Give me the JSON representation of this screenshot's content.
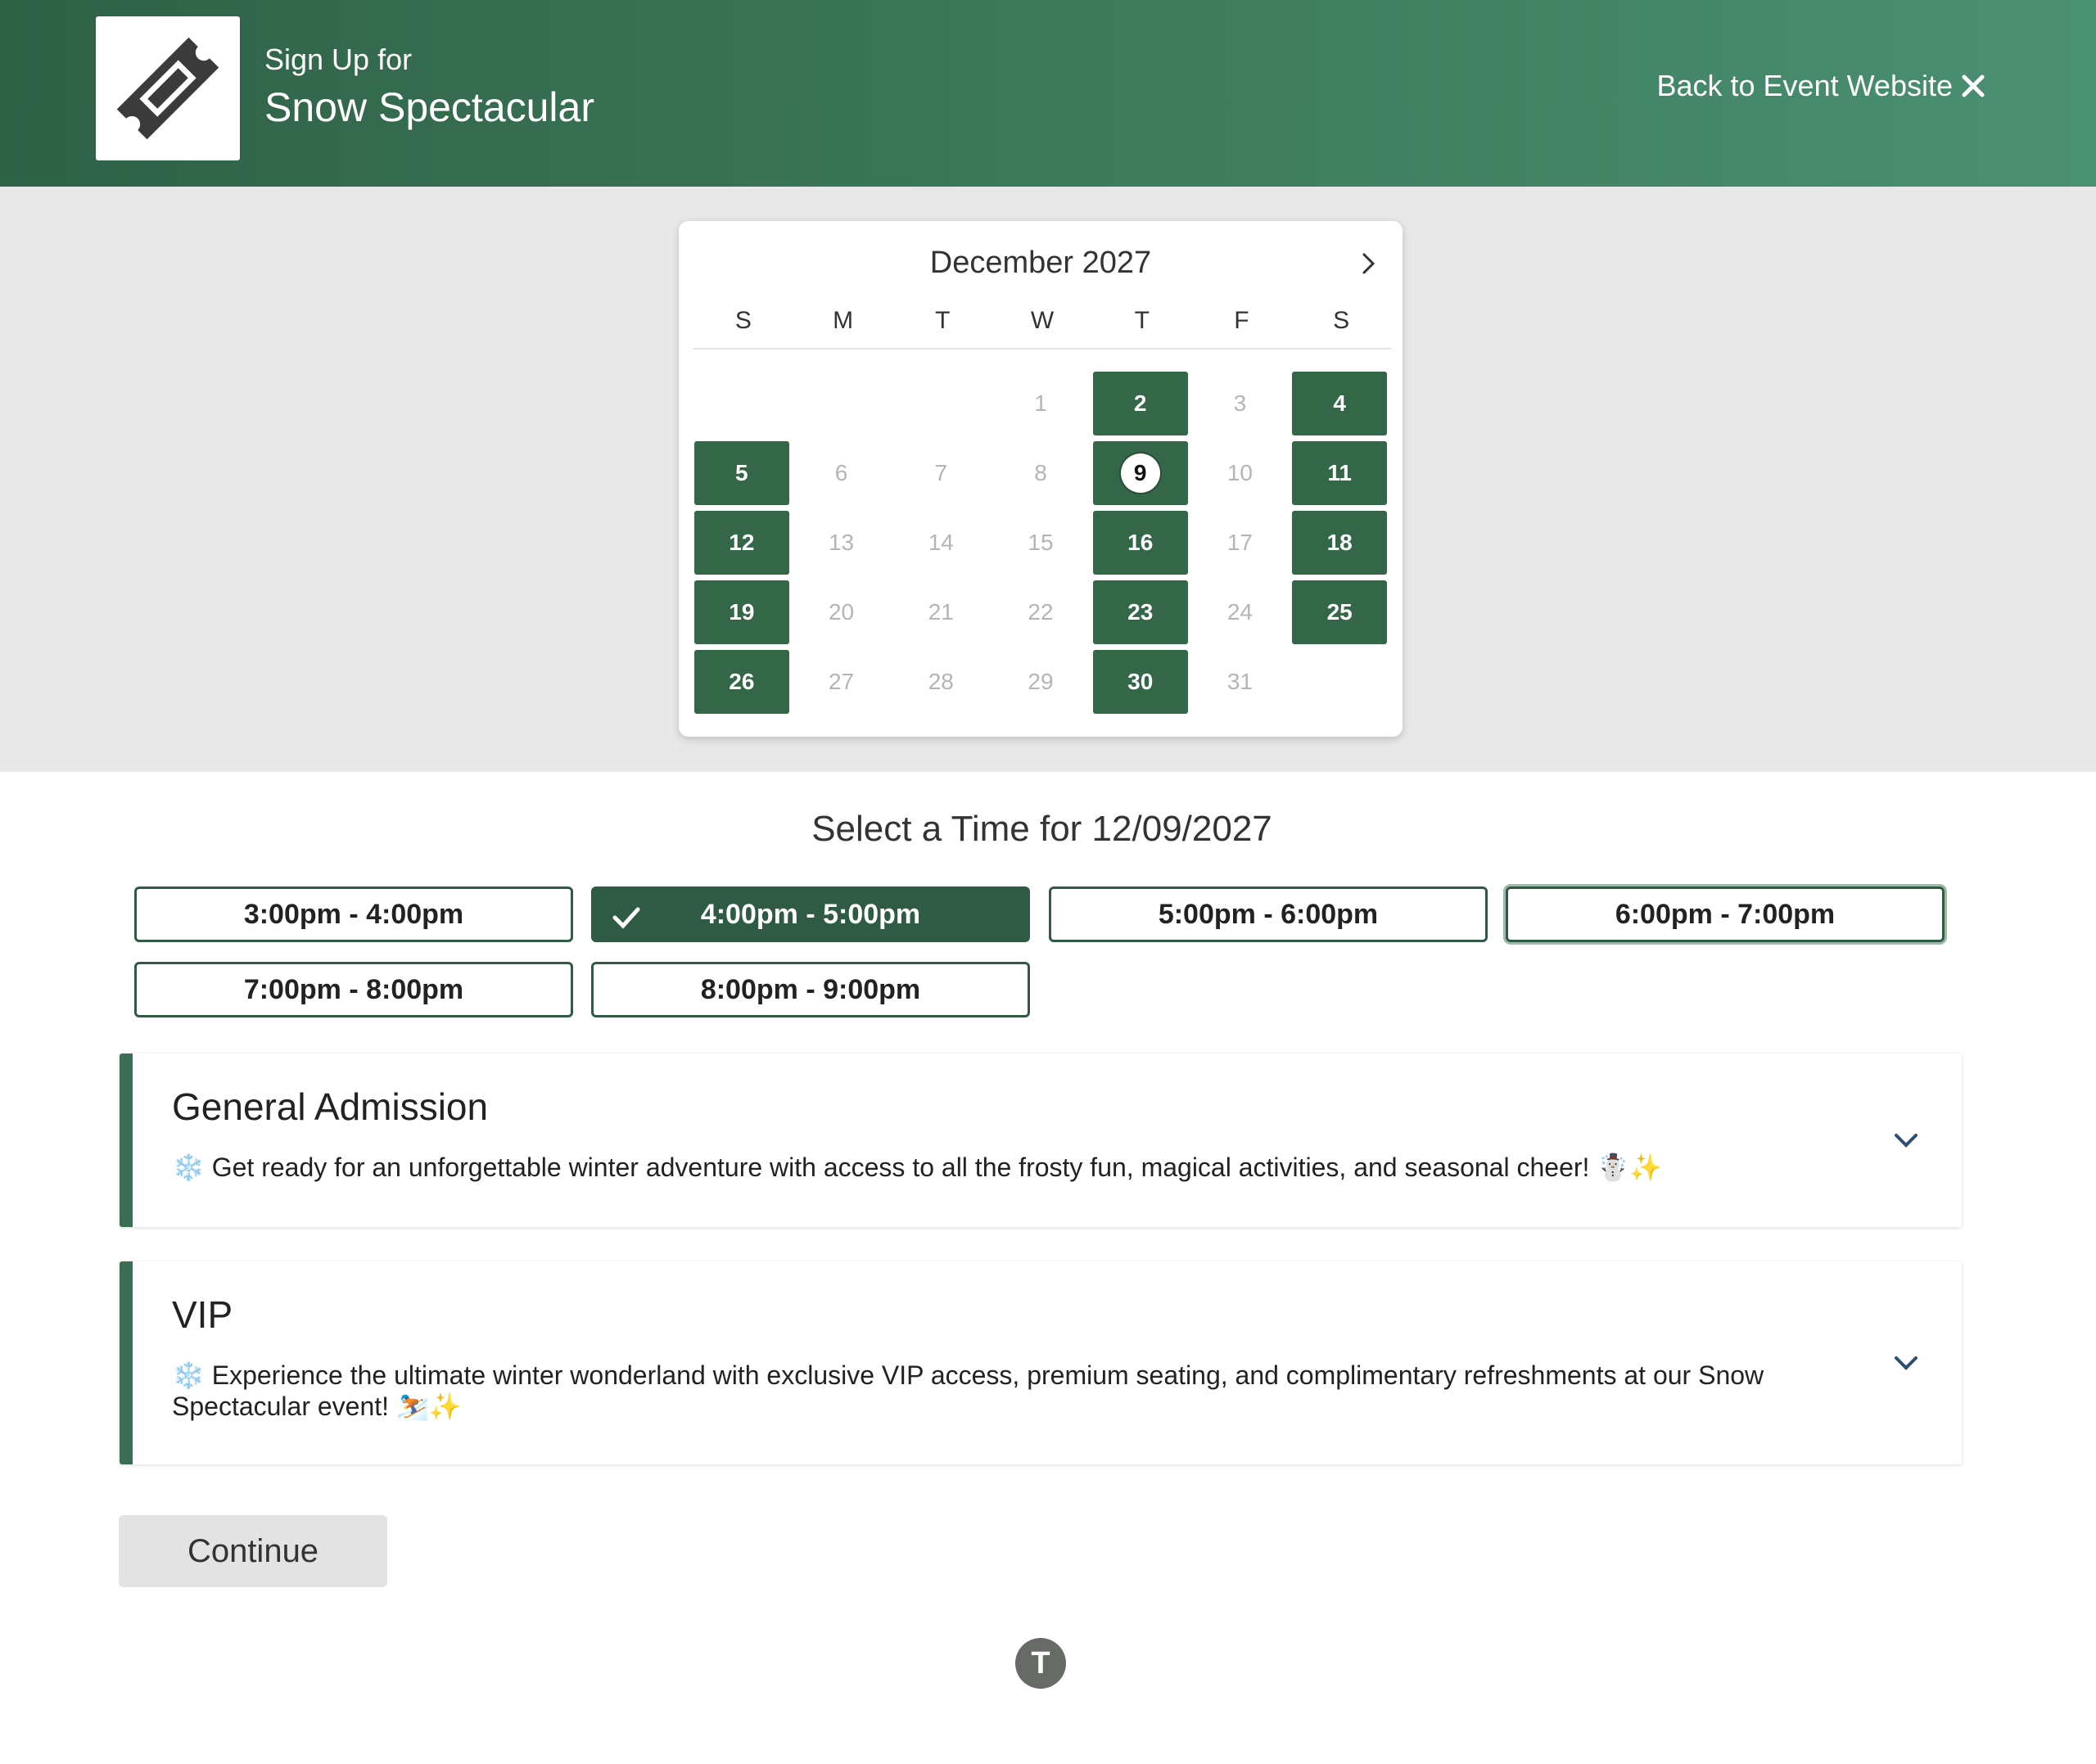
{
  "header": {
    "subtitle": "Sign Up for",
    "event_name": "Snow Spectacular",
    "back_link": "Back to Event Website",
    "back_icon": "close-icon",
    "logo_icon": "ticket-icon"
  },
  "calendar": {
    "month_label": "December 2027",
    "next_icon": "chevron-right-icon",
    "weekdays": [
      "S",
      "M",
      "T",
      "W",
      "T",
      "F",
      "S"
    ],
    "leading_blanks": 3,
    "days": [
      {
        "d": "1",
        "avail": false
      },
      {
        "d": "2",
        "avail": true
      },
      {
        "d": "3",
        "avail": false
      },
      {
        "d": "4",
        "avail": true
      },
      {
        "d": "5",
        "avail": true
      },
      {
        "d": "6",
        "avail": false
      },
      {
        "d": "7",
        "avail": false
      },
      {
        "d": "8",
        "avail": false
      },
      {
        "d": "9",
        "avail": true,
        "selected": true
      },
      {
        "d": "10",
        "avail": false
      },
      {
        "d": "11",
        "avail": true
      },
      {
        "d": "12",
        "avail": true
      },
      {
        "d": "13",
        "avail": false
      },
      {
        "d": "14",
        "avail": false
      },
      {
        "d": "15",
        "avail": false
      },
      {
        "d": "16",
        "avail": true
      },
      {
        "d": "17",
        "avail": false
      },
      {
        "d": "18",
        "avail": true
      },
      {
        "d": "19",
        "avail": true
      },
      {
        "d": "20",
        "avail": false
      },
      {
        "d": "21",
        "avail": false
      },
      {
        "d": "22",
        "avail": false
      },
      {
        "d": "23",
        "avail": true
      },
      {
        "d": "24",
        "avail": false
      },
      {
        "d": "25",
        "avail": true
      },
      {
        "d": "26",
        "avail": true
      },
      {
        "d": "27",
        "avail": false
      },
      {
        "d": "28",
        "avail": false
      },
      {
        "d": "29",
        "avail": false
      },
      {
        "d": "30",
        "avail": true
      },
      {
        "d": "31",
        "avail": false
      }
    ],
    "colors": {
      "available": "#346648",
      "unavailable_text": "#b5b5b5"
    }
  },
  "time_selection": {
    "heading": "Select a Time for 12/09/2027",
    "slots": [
      {
        "label": "3:00pm - 4:00pm",
        "state": "default"
      },
      {
        "label": "4:00pm - 5:00pm",
        "state": "selected"
      },
      {
        "label": "5:00pm - 6:00pm",
        "state": "default"
      },
      {
        "label": "6:00pm - 7:00pm",
        "state": "focused"
      },
      {
        "label": "7:00pm - 8:00pm",
        "state": "default"
      },
      {
        "label": "8:00pm - 9:00pm",
        "state": "default"
      }
    ],
    "selected_icon": "checkmark-icon"
  },
  "tickets": [
    {
      "name": "General Admission",
      "description": "❄️ Get ready for an unforgettable winter adventure with access to all the frosty fun, magical activities, and seasonal cheer! ☃️✨",
      "expand_icon": "chevron-down-icon"
    },
    {
      "name": "VIP",
      "description": "❄️ Experience the ultimate winter wonderland with exclusive VIP access, premium seating, and complimentary refreshments at our Snow Spectacular event! ⛷️✨",
      "expand_icon": "chevron-down-icon"
    }
  ],
  "actions": {
    "continue_label": "Continue"
  },
  "footer": {
    "badge_letter": "T"
  },
  "theme": {
    "primary": "#346648",
    "header_gradient_start": "#2f6147",
    "header_gradient_end": "#4a9072"
  }
}
